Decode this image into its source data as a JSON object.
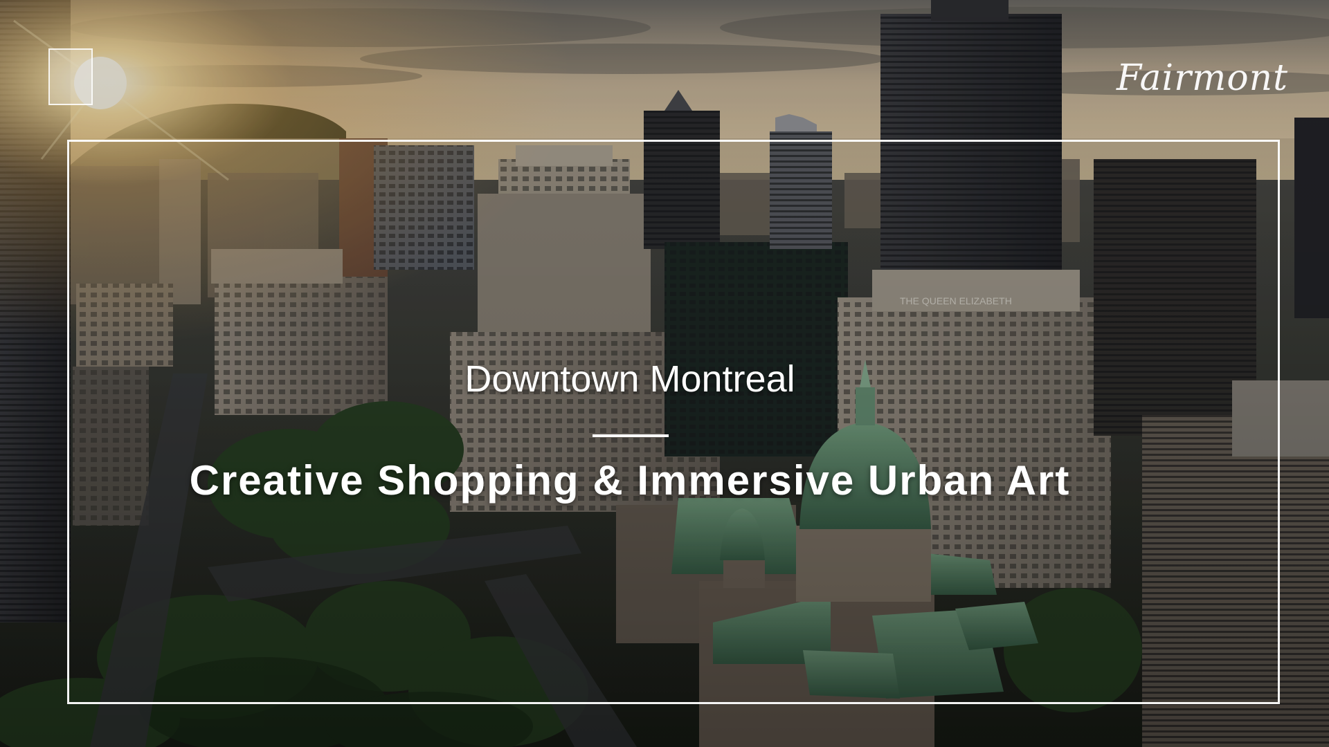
{
  "slide": {
    "subtitle": "Downtown Montreal",
    "title": "Creative Shopping & Immersive Urban Art",
    "logo_text": "Fairmont"
  },
  "photo": {
    "description_icon": "city-skyline-photo",
    "colors": {
      "sky_top": "#7d786f",
      "sky_glow": "#f3d49a",
      "sun": "#fff7d8",
      "tower_dark": "#2a2b2e",
      "tower_mid": "#4a4c52",
      "stone": "#8c8378",
      "copper_roof": "#5f8a6e",
      "trees": "#233a1f",
      "street": "#3b3d40"
    }
  }
}
